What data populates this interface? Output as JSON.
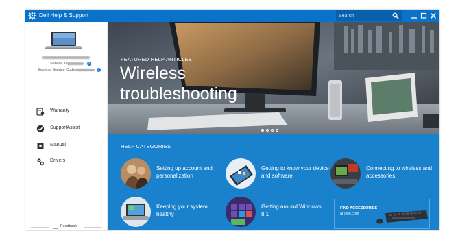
{
  "app": {
    "title": "Dell Help & Support",
    "accent_color": "#0a72c9",
    "icon": "dell-support-logo-icon"
  },
  "titlebar": {
    "search_placeholder": "Search",
    "search_icon": "search-icon",
    "controls": [
      "minimize-icon",
      "maximize-icon",
      "close-icon"
    ]
  },
  "sidebar": {
    "device_image": "laptop-icon",
    "service_tag_label": "Service Tag",
    "express_service_code_label": "Express Service Code",
    "nav": [
      {
        "label": "Warranty",
        "icon": "warranty-icon"
      },
      {
        "label": "SupportAssist",
        "icon": "supportassist-icon"
      },
      {
        "label": "Manual",
        "icon": "manual-icon"
      },
      {
        "label": "Drivers",
        "icon": "drivers-icon"
      }
    ],
    "feedback_label": "Feedback"
  },
  "hero": {
    "kicker": "FEATURED HELP ARTICLES",
    "title": "Wireless troubleshooting",
    "slides_total": 4,
    "active_slide": 1
  },
  "categories": {
    "heading": "HELP CATEGORIES",
    "items": [
      {
        "label": "Setting up account and personalization"
      },
      {
        "label": "Getting to know your device and software"
      },
      {
        "label": "Connecting to wireless and accessories"
      },
      {
        "label": "Keeping your system healthy"
      },
      {
        "label": "Getting around Windows 8.1"
      }
    ],
    "accessories": {
      "title": "FIND ACCESSORIES",
      "subtitle": "at Dell.com"
    }
  }
}
